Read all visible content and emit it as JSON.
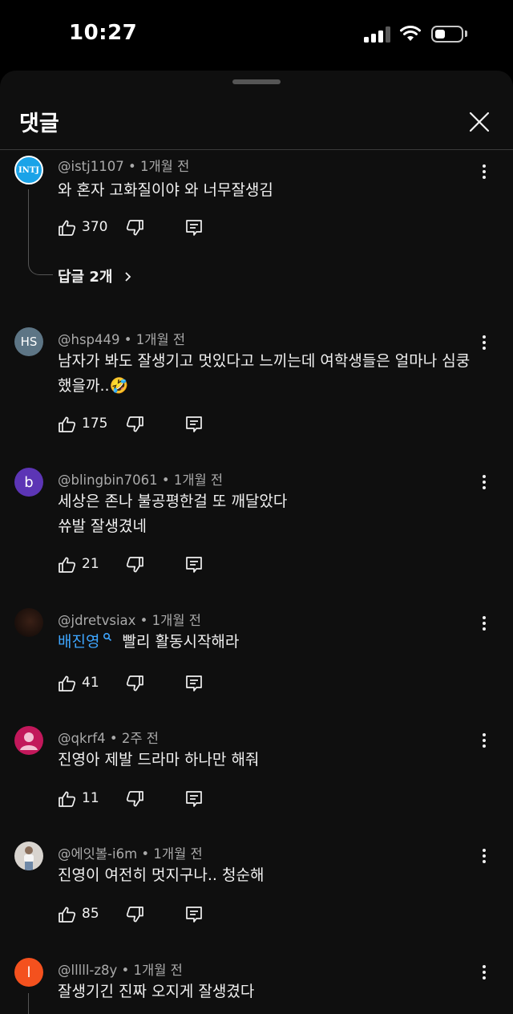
{
  "status_bar": {
    "time": "10:27"
  },
  "sheet": {
    "title": "댓글"
  },
  "comments": [
    {
      "author": "@istj1107",
      "time": "1개월 전",
      "text": "와 혼자 고화질이야 와 너무잘생김",
      "likes": "370",
      "avatar_text": "INTJ",
      "replies_label": "답글 2개"
    },
    {
      "author": "@hsp449",
      "time": "1개월 전",
      "text_line1": "남자가 봐도 잘생기고 멋있다고 느끼는데 여학생들은 얼마나 심쿵",
      "text_line2": "했을까..🤣",
      "likes": "175",
      "avatar_text": "HS"
    },
    {
      "author": "@blingbin7061",
      "time": "1개월 전",
      "text_line1": "세상은 존나 불공평한걸 또 깨달았다",
      "text_line2": "쓔발 잘생겼네",
      "likes": "21",
      "avatar_text": "b"
    },
    {
      "author": "@jdretvsiax",
      "time": "1개월 전",
      "mention": "배진영",
      "text": "빨리 활동시작해라",
      "likes": "41"
    },
    {
      "author": "@qkrf4",
      "time": "2주 전",
      "text": "진영아 제발 드라마 하나만 해줘",
      "likes": "11"
    },
    {
      "author": "@에잇볼-i6m",
      "time": "1개월 전",
      "text": "진영이 여전히 멋지구나..  청순해",
      "likes": "85"
    },
    {
      "author": "@lllll-z8y",
      "time": "1개월 전",
      "text": "잘생기긴 진짜 오지게 잘생겼다",
      "avatar_text": "l"
    }
  ],
  "colors": {
    "background": "#0f0f0f",
    "text": "#f1f1f1",
    "meta": "#aaaaaa",
    "link": "#3ea6ff"
  }
}
